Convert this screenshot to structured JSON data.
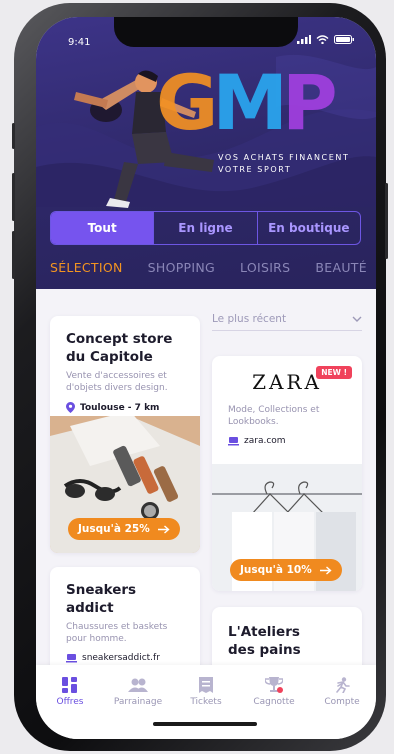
{
  "status_bar": {
    "time": "9:41"
  },
  "hero": {
    "logo_letters": [
      "G",
      "M",
      "P"
    ],
    "logo_colors": [
      "#f29123",
      "#2aa8f0",
      "#a23fe0"
    ],
    "tagline_line1": "VOS ACHATS FINANCENT",
    "tagline_line2": "VOTRE SPORT"
  },
  "segmented": {
    "options": [
      "Tout",
      "En ligne",
      "En boutique"
    ],
    "selected": "Tout"
  },
  "tabs": {
    "items": [
      "SÉLECTION",
      "SHOPPING",
      "LOISIRS",
      "BEAUTÉ"
    ],
    "selected": "SÉLECTION"
  },
  "sort": {
    "label": "Le plus récent"
  },
  "offers": [
    {
      "title_line1": "Concept store",
      "title_line2": "du Capitole",
      "desc_line1": "Vente d'accessoires et",
      "desc_line2": "d'objets divers design.",
      "location": "Toulouse - 7 km",
      "cta": "Jusqu'à 25%"
    },
    {
      "brand": "ZARA",
      "badge": "NEW !",
      "desc_line1": "Mode, Collections et",
      "desc_line2": "Lookbooks.",
      "site": "zara.com",
      "cta": "Jusqu'à 10%"
    },
    {
      "title_line1": "Sneakers",
      "title_line2": "addict",
      "desc_line1": "Chaussures et baskets",
      "desc_line2": "pour homme.",
      "site": "sneakersaddict.fr"
    },
    {
      "title_line1": "L'Ateliers",
      "title_line2": "des pains"
    }
  ],
  "bottom_nav": {
    "items": [
      "Offres",
      "Parrainage",
      "Tickets",
      "Cagnotte",
      "Compte"
    ],
    "selected": "Offres"
  },
  "colors": {
    "accent": "#7654ee",
    "orange": "#f08a1f",
    "hero_bg": "#2d2766"
  }
}
